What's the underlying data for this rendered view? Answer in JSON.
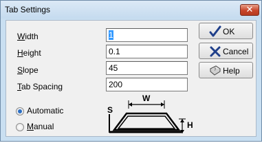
{
  "window": {
    "title": "Tab Settings",
    "close_glyph": "✕"
  },
  "fields": [
    {
      "label_key": "W",
      "label_rest": "idth",
      "value": "1"
    },
    {
      "label_key": "H",
      "label_rest": "eight",
      "value": "0.1"
    },
    {
      "label_key": "S",
      "label_rest": "lope",
      "value": "45"
    },
    {
      "label_key": "T",
      "label_rest": "ab Spacing",
      "value": "200"
    }
  ],
  "buttons": [
    {
      "label": "OK",
      "icon": "checkmark-icon"
    },
    {
      "label": "Cancel",
      "icon": "x-icon"
    },
    {
      "label": "Help",
      "icon": "help-book-icon"
    }
  ],
  "mode": {
    "options": [
      {
        "label": "Automatic",
        "selected": true
      },
      {
        "label_key": "M",
        "label_rest": "anual",
        "selected": false
      }
    ]
  },
  "diagram": {
    "w_label": "W",
    "s_label": "S",
    "h_label": "H"
  }
}
